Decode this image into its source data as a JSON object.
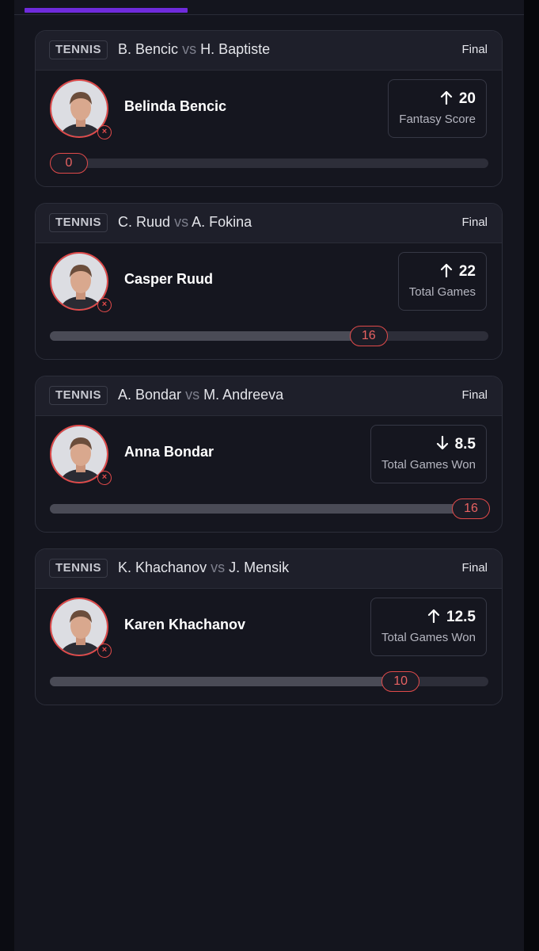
{
  "theme": {
    "accent": "#6f2bdc",
    "miss": "#e04a4a"
  },
  "cards": [
    {
      "sport": "TENNIS",
      "player1": "B. Bencic",
      "vs": "vs",
      "player2": "H. Baptiste",
      "status": "Final",
      "player_name": "Belinda Bencic",
      "direction": "up",
      "line": "20",
      "stat_label": "Fantasy Score",
      "actual": "0",
      "actual_value": 0,
      "progress": 0.0,
      "avatar_icon": "player-headshot"
    },
    {
      "sport": "TENNIS",
      "player1": "C. Ruud",
      "vs": "vs",
      "player2": "A. Fokina",
      "status": "Final",
      "player_name": "Casper Ruud",
      "direction": "up",
      "line": "22",
      "stat_label": "Total Games",
      "actual": "16",
      "actual_value": 16,
      "progress": 0.727,
      "avatar_icon": "player-headshot"
    },
    {
      "sport": "TENNIS",
      "player1": "A. Bondar",
      "vs": "vs",
      "player2": "M. Andreeva",
      "status": "Final",
      "player_name": "Anna Bondar",
      "direction": "down",
      "line": "8.5",
      "stat_label": "Total Games Won",
      "actual": "16",
      "actual_value": 16,
      "progress": 1.0,
      "avatar_icon": "player-headshot"
    },
    {
      "sport": "TENNIS",
      "player1": "K. Khachanov",
      "vs": "vs",
      "player2": "J. Mensik",
      "status": "Final",
      "player_name": "Karen Khachanov",
      "direction": "up",
      "line": "12.5",
      "stat_label": "Total Games Won",
      "actual": "10",
      "actual_value": 10,
      "progress": 0.8,
      "avatar_icon": "player-headshot"
    }
  ]
}
